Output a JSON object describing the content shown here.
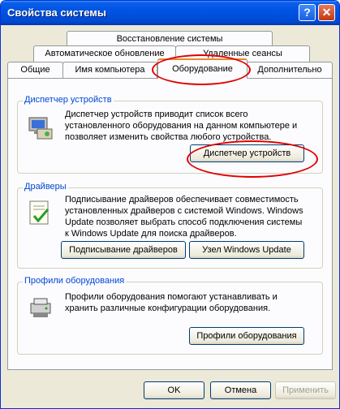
{
  "window": {
    "title": "Свойства системы"
  },
  "titlebar": {
    "help_glyph": "?",
    "close_glyph": "✕"
  },
  "tabs": {
    "row1": [
      "Восстановление системы"
    ],
    "row2": [
      "Автоматическое обновление",
      "Удаленные сеансы"
    ],
    "row3": [
      "Общие",
      "Имя компьютера",
      "Оборудование",
      "Дополнительно"
    ],
    "selected": "Оборудование"
  },
  "device_manager": {
    "title": "Диспетчер устройств",
    "text": [
      "Диспетчер устройств приводит список всего",
      "установленного оборудования на данном компьютере и",
      "позволяет изменить свойства любого устройства."
    ],
    "button": "Диспетчер устройств"
  },
  "drivers": {
    "title": "Драйверы",
    "text": [
      "Подписывание драйверов обеспечивает совместимость",
      "установленных драйверов с системой Windows.  Windows",
      "Update позволяет выбрать способ подключения системы",
      "к Windows Update для поиска драйверов."
    ],
    "signing_button": "Подписывание драйверов",
    "update_button": "Узел Windows Update"
  },
  "hardware_profiles": {
    "title": "Профили оборудования",
    "text": [
      "Профили оборудования помогают устанавливать и",
      "хранить различные конфигурации оборудования."
    ],
    "button": "Профили оборудования"
  },
  "footer": {
    "ok": "OK",
    "cancel": "Отмена",
    "apply": "Применить"
  },
  "colors": {
    "titlebar": "#0054e3",
    "group_title": "#0046d5",
    "annotation": "#e00000",
    "window_bg": "#ece9d8"
  },
  "icons": [
    "help-icon",
    "close-icon",
    "device-manager-icon",
    "drivers-icon",
    "hardware-profiles-icon"
  ]
}
